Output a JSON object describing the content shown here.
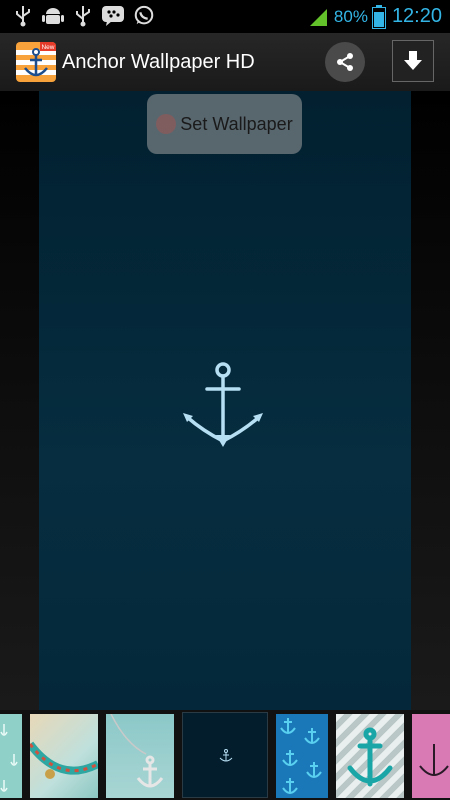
{
  "status_bar": {
    "notification_icons": [
      "usb-icon",
      "android-debug-icon",
      "usb-icon",
      "bbm-icon",
      "whatsapp-icon"
    ],
    "signal_icon": "signal-icon",
    "battery_percent": "80%",
    "battery_icon": "battery-icon",
    "time": "12:20",
    "accent_color": "#33b5e5"
  },
  "action_bar": {
    "app_icon": "anchor-app-icon",
    "app_icon_badge": "New",
    "title": "Anchor Wallpaper HD",
    "share_icon": "share-icon",
    "download_icon": "download-icon"
  },
  "preview": {
    "set_wallpaper_label": "Set Wallpaper",
    "anchor_icon": "anchor-icon"
  },
  "gallery": {
    "thumbnails": [
      {
        "name": "thumb-teal-anchors"
      },
      {
        "name": "thumb-beaded-bracelet"
      },
      {
        "name": "thumb-anchor-necklace"
      },
      {
        "name": "thumb-dark-anchor-selected"
      },
      {
        "name": "thumb-blue-anchor-pattern"
      },
      {
        "name": "thumb-chevron-anchor"
      },
      {
        "name": "thumb-pink-anchor"
      }
    ]
  }
}
